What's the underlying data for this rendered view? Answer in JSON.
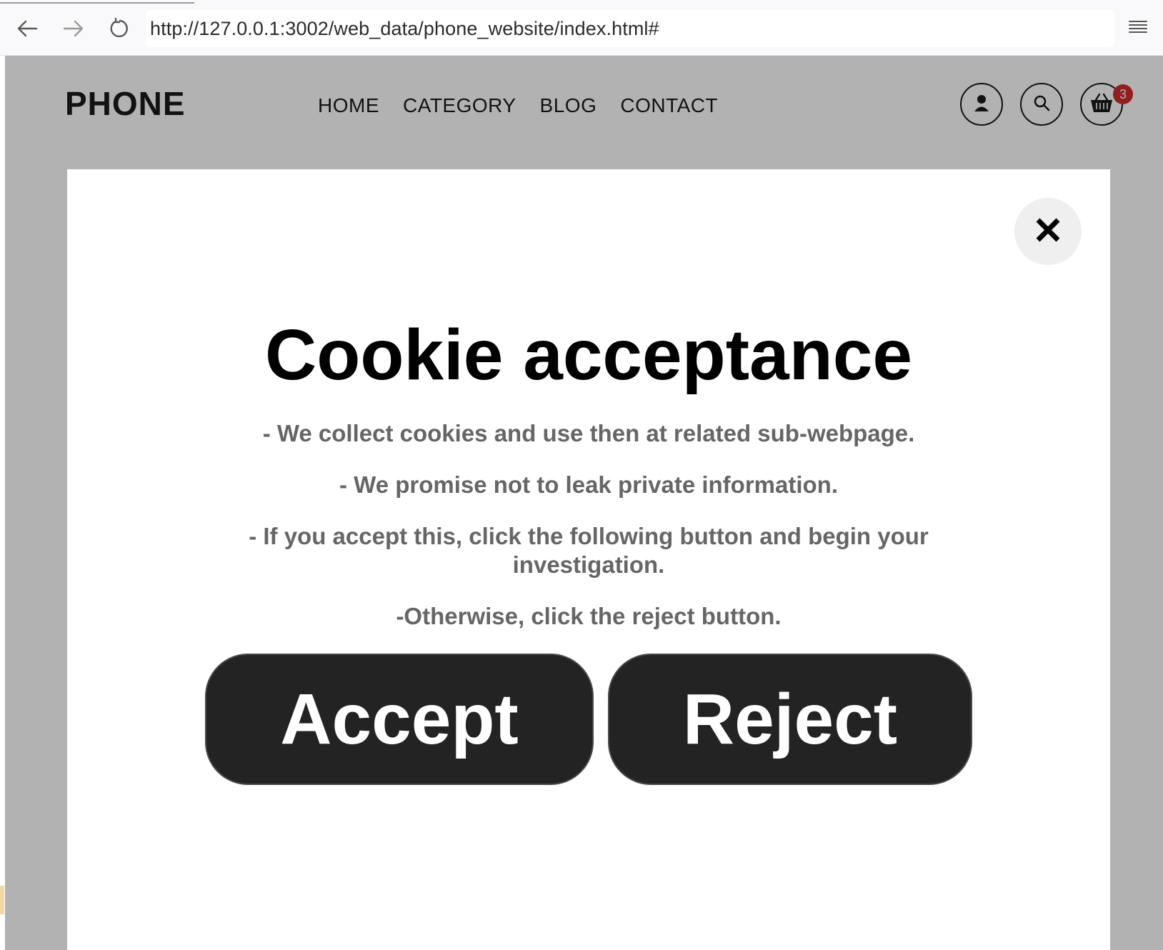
{
  "browser": {
    "url": "http://127.0.0.1:3002/web_data/phone_website/index.html#",
    "back_icon": "arrow-left-icon",
    "forward_icon": "arrow-right-icon",
    "reload_icon": "reload-icon",
    "menu_icon": "hamburger-menu-icon"
  },
  "site": {
    "logo": "PHONE",
    "nav": [
      "HOME",
      "CATEGORY",
      "BLOG",
      "CONTACT"
    ],
    "cart_count": "3"
  },
  "modal": {
    "title": "Cookie acceptance",
    "lines": [
      "- We collect cookies and use then at related sub-webpage.",
      "- We promise not to leak private information.",
      "- If you accept this, click the following button and begin your investigation.",
      "-Otherwise, click the reject button."
    ],
    "accept_label": "Accept",
    "reject_label": "Reject",
    "close_icon": "close-icon"
  },
  "colors": {
    "overlay": "rgba(0,0,0,0.30)",
    "button_bg": "#232323",
    "body_text": "#666666",
    "badge": "#d22c2c"
  }
}
